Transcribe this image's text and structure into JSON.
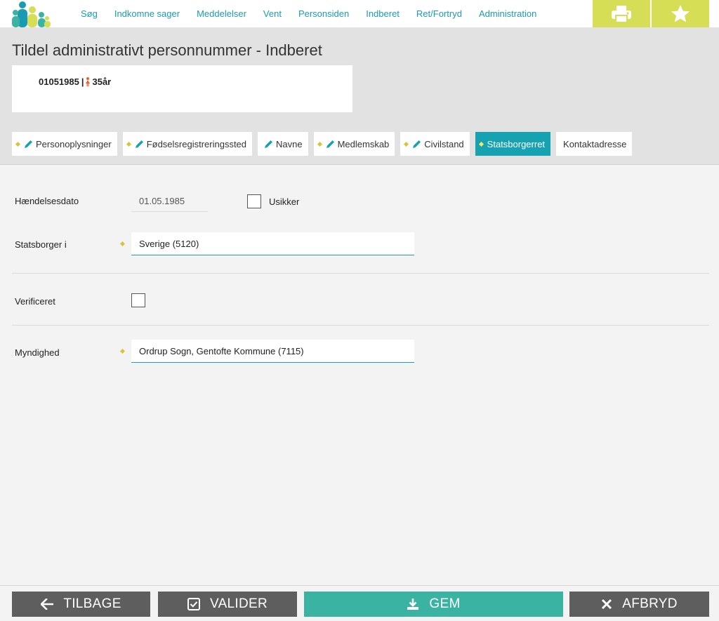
{
  "nav": {
    "items": [
      "Søg",
      "Indkomne sager",
      "Meddelelser",
      "Vent",
      "Personsiden",
      "Indberet",
      "Ret/Fortryd",
      "Administration"
    ]
  },
  "page": {
    "title": "Tildel administrativt personnummer - Indberet"
  },
  "person": {
    "id": "01051985",
    "separator": "|",
    "age": "35år"
  },
  "tabs": {
    "items": [
      {
        "label": "Personoplysninger",
        "dot": true,
        "pencil": true,
        "active": false
      },
      {
        "label": "Fødselsregistreringssted",
        "dot": true,
        "pencil": true,
        "active": false
      },
      {
        "label": "Navne",
        "dot": false,
        "pencil": true,
        "active": false
      },
      {
        "label": "Medlemskab",
        "dot": true,
        "pencil": true,
        "active": false
      },
      {
        "label": "Civilstand",
        "dot": true,
        "pencil": true,
        "active": false
      },
      {
        "label": "Statsborgerret",
        "dot": true,
        "pencil": false,
        "active": true
      },
      {
        "label": "Kontaktadresse",
        "dot": false,
        "pencil": false,
        "active": false
      }
    ]
  },
  "form": {
    "event_date_label": "Hændelsesdato",
    "event_date_value": "01.05.1985",
    "uncertain_label": "Usikker",
    "uncertain_checked": false,
    "citizen_label": "Statsborger i",
    "citizen_value": "Sverige (5120)",
    "verified_label": "Verificeret",
    "verified_checked": false,
    "authority_label": "Myndighed",
    "authority_value": "Ordrup Sogn, Gentofte Kommune (7115)"
  },
  "footer": {
    "back_label": "TILBAGE",
    "validate_label": "VALIDER",
    "save_label": "GEM",
    "cancel_label": "AFBRYD"
  },
  "icons": {
    "logo": "people-logo-icon",
    "print": "printer-icon",
    "favorite": "star-icon",
    "back": "arrow-left-icon",
    "validate": "checkbox-check-icon",
    "save": "download-icon",
    "cancel": "close-icon"
  },
  "colors": {
    "accent": "#17a2b2",
    "top_button": "#d5de54",
    "required_dot": "#d5c53a",
    "save_button": "#3bb3a3",
    "footer_button": "#5e5e5e",
    "person_icon": "#e8622c"
  }
}
